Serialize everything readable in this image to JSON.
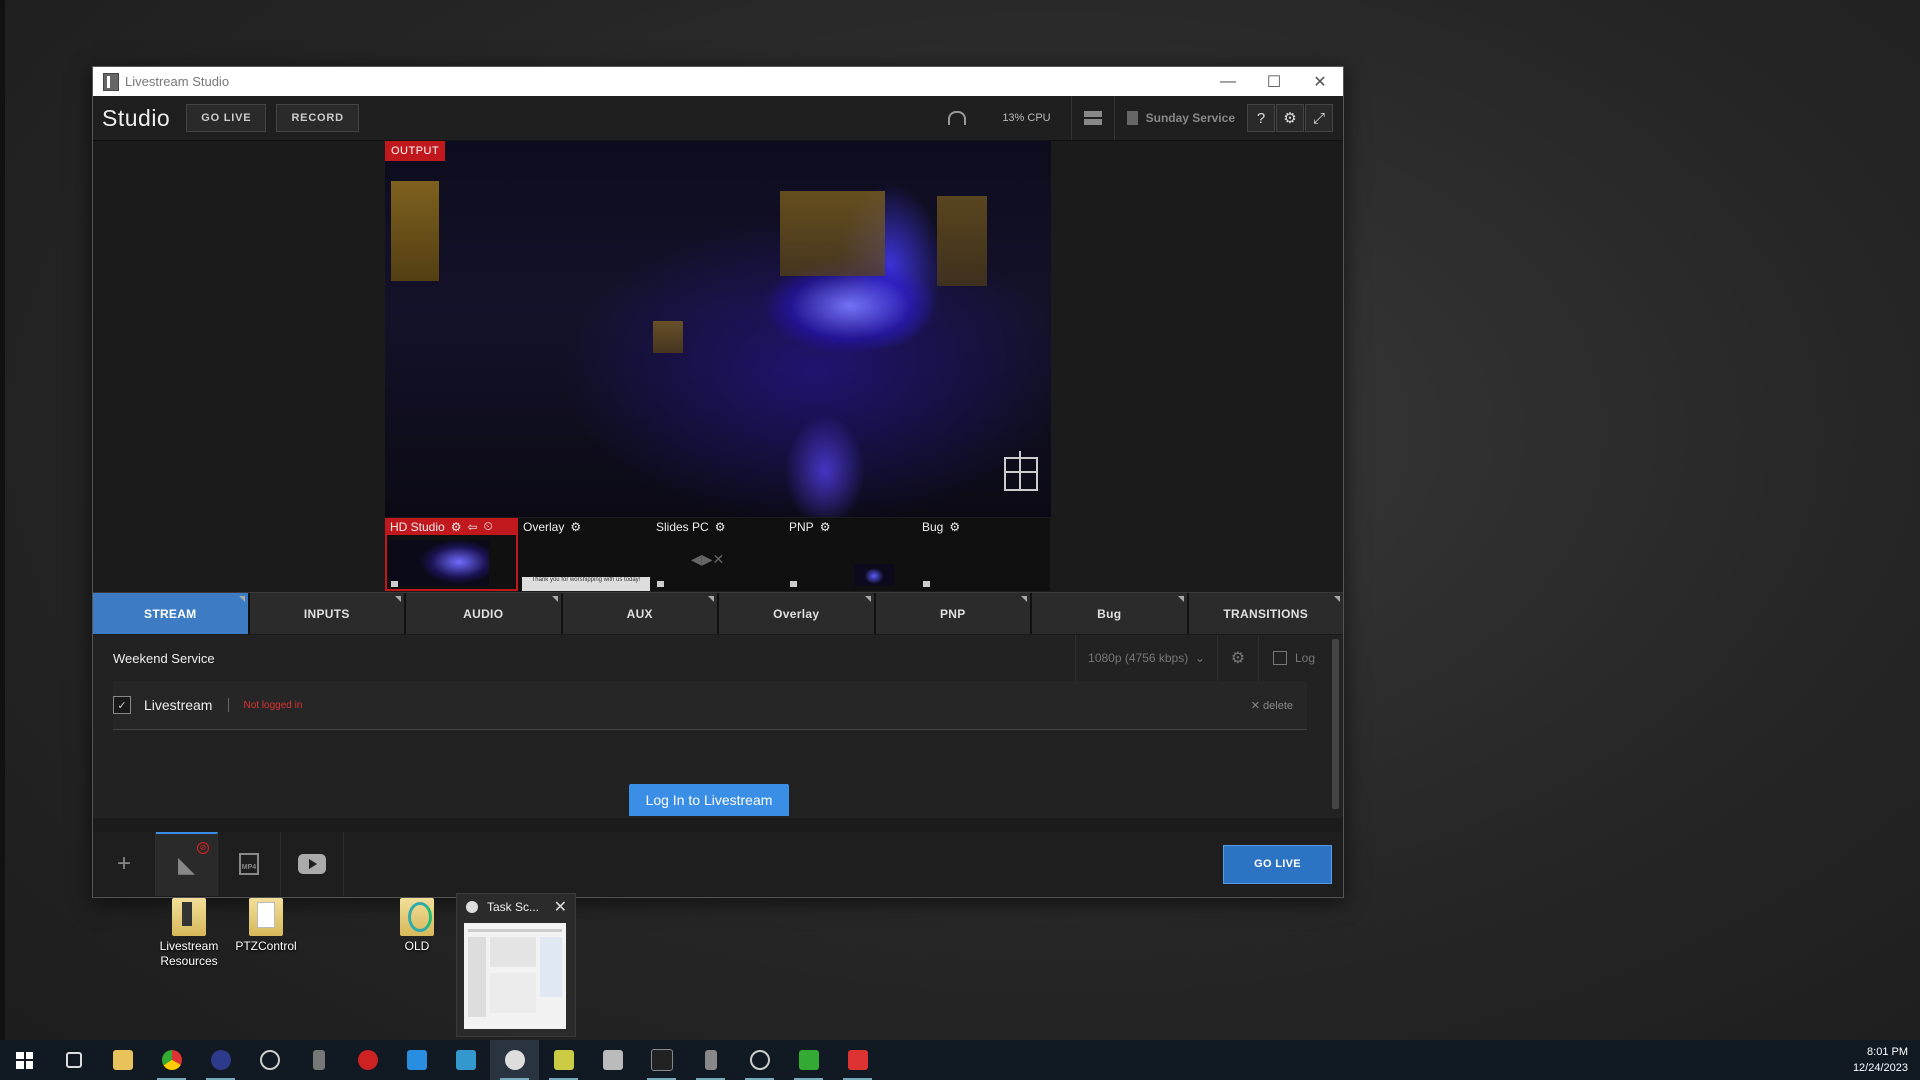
{
  "window": {
    "title": "Livestream Studio",
    "controls": {
      "minimize": "—",
      "maximize": "☐",
      "close": "✕"
    }
  },
  "toolbar": {
    "brand": "Studio",
    "go_live": "GO LIVE",
    "record": "RECORD",
    "cpu": "13% CPU",
    "preset": "Sunday Service",
    "help_icon": "?",
    "settings_icon": "⚙",
    "fullscreen_icon": "⤢"
  },
  "output": {
    "tag": "OUTPUT"
  },
  "sources": [
    {
      "label": "HD Studio",
      "active": true
    },
    {
      "label": "Overlay",
      "active": false,
      "thumb_text": "Thank you for worshipping with us today!"
    },
    {
      "label": "Slides PC",
      "active": false
    },
    {
      "label": "PNP",
      "active": false
    },
    {
      "label": "Bug",
      "active": false
    }
  ],
  "tabs": [
    "STREAM",
    "INPUTS",
    "AUDIO",
    "AUX",
    "Overlay",
    "PNP",
    "Bug",
    "TRANSITIONS"
  ],
  "stream": {
    "title": "Weekend Service",
    "quality": "1080p (4756 kbps)",
    "log": "Log",
    "row": {
      "name": "Livestream",
      "status": "Not logged in",
      "delete": "delete"
    },
    "login_button": "Log In to Livestream"
  },
  "bottom": {
    "add": "+",
    "mp4": "MP4",
    "go_live": "GO LIVE"
  },
  "desktop_icons": [
    {
      "label": "Livestream Resources"
    },
    {
      "label": "PTZControl"
    },
    {
      "label": "OLD"
    }
  ],
  "task_preview": {
    "title": "Task Sc...",
    "close": "✕"
  },
  "clock": {
    "time": "8:01 PM",
    "date": "12/24/2023"
  },
  "colors": {
    "accent": "#3d7cc4",
    "live_red": "#c0181c",
    "login_blue": "#3a8ee6"
  }
}
